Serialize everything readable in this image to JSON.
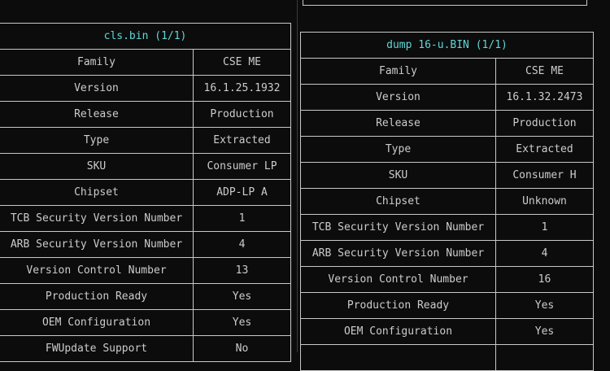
{
  "left_table": {
    "title": "cls.bin (1/1)",
    "rows": [
      {
        "label": "Family",
        "value": "CSE ME"
      },
      {
        "label": "Version",
        "value": "16.1.25.1932"
      },
      {
        "label": "Release",
        "value": "Production"
      },
      {
        "label": "Type",
        "value": "Extracted"
      },
      {
        "label": "SKU",
        "value": "Consumer LP"
      },
      {
        "label": "Chipset",
        "value": "ADP-LP A"
      },
      {
        "label": "TCB Security Version Number",
        "value": "1"
      },
      {
        "label": "ARB Security Version Number",
        "value": "4"
      },
      {
        "label": "Version Control Number",
        "value": "13"
      },
      {
        "label": "Production Ready",
        "value": "Yes"
      },
      {
        "label": "OEM Configuration",
        "value": "Yes"
      },
      {
        "label": "FWUpdate Support",
        "value": "No"
      }
    ]
  },
  "right_table": {
    "title": "dump 16-u.BIN (1/1)",
    "rows": [
      {
        "label": "Family",
        "value": "CSE ME"
      },
      {
        "label": "Version",
        "value": "16.1.32.2473"
      },
      {
        "label": "Release",
        "value": "Production"
      },
      {
        "label": "Type",
        "value": "Extracted"
      },
      {
        "label": "SKU",
        "value": "Consumer H"
      },
      {
        "label": "Chipset",
        "value": "Unknown"
      },
      {
        "label": "TCB Security Version Number",
        "value": "1"
      },
      {
        "label": "ARB Security Version Number",
        "value": "4"
      },
      {
        "label": "Version Control Number",
        "value": "16"
      },
      {
        "label": "Production Ready",
        "value": "Yes"
      },
      {
        "label": "OEM Configuration",
        "value": "Yes"
      },
      {
        "label": "",
        "value": ""
      }
    ]
  }
}
